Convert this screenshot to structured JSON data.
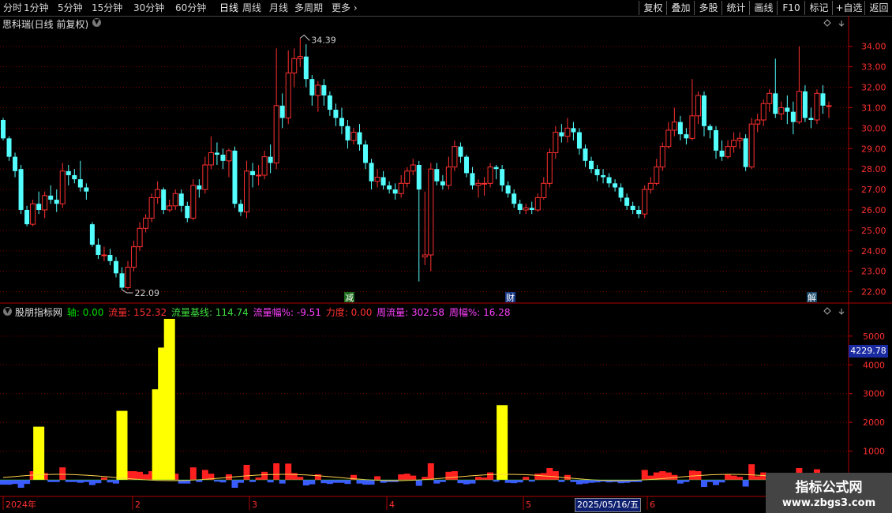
{
  "toolbar": {
    "periods": [
      "分时",
      "1分钟",
      "5分钟",
      "15分钟",
      "30分钟",
      "60分钟",
      "日线",
      "周线",
      "月线",
      "多周期",
      "更多"
    ],
    "active_period": "日线",
    "right_buttons": [
      "复权",
      "叠加",
      "多股",
      "统计",
      "画线",
      "F10",
      "标记",
      "+自选",
      "返回"
    ]
  },
  "stock": {
    "title": "思科瑞(日线 前复权)",
    "high_label": "34.39",
    "low_label": "22.09"
  },
  "price_axis": [
    "34.00",
    "33.00",
    "32.00",
    "31.00",
    "30.00",
    "29.00",
    "28.00",
    "27.00",
    "26.00",
    "25.00",
    "24.00",
    "23.00",
    "22.00"
  ],
  "markers": {
    "reduce": "减",
    "finance": "财",
    "unlock": "解"
  },
  "indicator": {
    "name": "股朋指标网",
    "axis_label": "轴: 0.00",
    "flow_label": "流量: 152.32",
    "baseline_label": "流量基线: 114.74",
    "flow_pct_label": "流量幅%: -9.51",
    "force_label": "力度: 0.00",
    "weekly_flow_label": "周流量: 302.58",
    "weekly_pct_label": "周幅%: 16.28",
    "axis_ticks": [
      "5000",
      "4000",
      "3000",
      "2000",
      "1000"
    ],
    "current_value": "4229.78"
  },
  "date_axis": {
    "labels": [
      "2024年",
      "2",
      "3",
      "4",
      "5",
      "6"
    ],
    "highlight": "2025/05/16/五"
  },
  "watermark": {
    "line1": "指标公式网",
    "line2": "www.zbgs3.com"
  },
  "colors": {
    "up": "#ff3030",
    "down": "#54ffff",
    "volume_spike": "#ffff00",
    "neg_bar": "#3a5cff",
    "grid": "#8b0000"
  },
  "chart_data": {
    "type": "candlestick",
    "ylim": [
      21.6,
      34.8
    ],
    "candles": [
      [
        30.4,
        29.5,
        30.5,
        29.4
      ],
      [
        29.5,
        28.6,
        29.6,
        28.4
      ],
      [
        28.6,
        27.9,
        28.8,
        27.6
      ],
      [
        28.0,
        26.0,
        28.2,
        25.8
      ],
      [
        26.0,
        25.3,
        26.2,
        25.2
      ],
      [
        25.3,
        26.3,
        26.5,
        25.2
      ],
      [
        26.3,
        26.0,
        26.9,
        25.8
      ],
      [
        26.0,
        26.7,
        26.9,
        25.6
      ],
      [
        26.7,
        26.5,
        27.2,
        26.3
      ],
      [
        26.5,
        26.3,
        27.0,
        25.9
      ],
      [
        26.3,
        27.9,
        28.3,
        26.1
      ],
      [
        27.9,
        27.7,
        28.2,
        27.2
      ],
      [
        27.7,
        27.5,
        28.0,
        27.3
      ],
      [
        27.5,
        27.1,
        28.4,
        26.9
      ],
      [
        27.1,
        26.9,
        27.3,
        26.5
      ],
      [
        25.3,
        24.3,
        25.4,
        24.2
      ],
      [
        24.3,
        23.8,
        24.6,
        23.6
      ],
      [
        23.8,
        23.8,
        24.2,
        23.5
      ],
      [
        23.8,
        23.5,
        24.1,
        23.3
      ],
      [
        23.5,
        22.9,
        23.7,
        22.7
      ],
      [
        22.9,
        22.2,
        23.2,
        22.1
      ],
      [
        22.2,
        23.2,
        23.5,
        22.1
      ],
      [
        23.2,
        24.2,
        24.5,
        23.0
      ],
      [
        24.2,
        25.1,
        25.4,
        24.0
      ],
      [
        25.1,
        25.6,
        25.8,
        24.9
      ],
      [
        25.6,
        26.6,
        26.8,
        25.4
      ],
      [
        26.6,
        27.0,
        27.4,
        26.3
      ],
      [
        27.0,
        26.0,
        27.1,
        25.8
      ],
      [
        26.0,
        26.2,
        26.5,
        25.9
      ],
      [
        26.2,
        26.8,
        27.0,
        26.0
      ],
      [
        26.8,
        26.2,
        27.0,
        25.9
      ],
      [
        26.2,
        25.6,
        26.4,
        25.4
      ],
      [
        25.6,
        27.2,
        27.5,
        25.5
      ],
      [
        27.2,
        27.0,
        27.5,
        26.6
      ],
      [
        27.0,
        28.2,
        28.6,
        26.8
      ],
      [
        28.2,
        28.8,
        29.6,
        28.0
      ],
      [
        28.8,
        28.7,
        29.3,
        28.2
      ],
      [
        28.7,
        28.4,
        29.0,
        28.0
      ],
      [
        28.4,
        28.9,
        29.0,
        27.6
      ],
      [
        28.9,
        26.3,
        29.1,
        26.1
      ],
      [
        26.3,
        25.9,
        26.5,
        25.7
      ],
      [
        25.9,
        27.9,
        28.4,
        25.6
      ],
      [
        27.9,
        27.7,
        28.3,
        27.1
      ],
      [
        27.7,
        27.7,
        28.2,
        27.2
      ],
      [
        27.7,
        28.6,
        28.9,
        27.5
      ],
      [
        28.6,
        28.3,
        29.2,
        27.8
      ],
      [
        28.3,
        31.1,
        33.9,
        28.0
      ],
      [
        31.1,
        30.5,
        31.7,
        30.0
      ],
      [
        30.5,
        32.7,
        33.8,
        30.2
      ],
      [
        32.7,
        33.4,
        33.9,
        32.0
      ],
      [
        33.4,
        33.5,
        34.4,
        33.0
      ],
      [
        33.5,
        32.4,
        34.1,
        32.0
      ],
      [
        32.4,
        31.6,
        32.6,
        31.1
      ],
      [
        31.6,
        32.1,
        32.3,
        30.8
      ],
      [
        32.1,
        31.6,
        32.4,
        31.1
      ],
      [
        31.6,
        30.9,
        31.8,
        30.6
      ],
      [
        30.9,
        30.5,
        31.2,
        30.1
      ],
      [
        30.5,
        30.1,
        31.0,
        29.7
      ],
      [
        30.1,
        29.4,
        30.4,
        29.0
      ],
      [
        29.4,
        29.8,
        30.0,
        29.2
      ],
      [
        29.8,
        29.2,
        30.2,
        28.9
      ],
      [
        29.2,
        28.3,
        29.4,
        28.0
      ],
      [
        28.3,
        27.4,
        28.5,
        27.0
      ],
      [
        27.4,
        27.6,
        28.0,
        27.1
      ],
      [
        27.6,
        27.2,
        27.9,
        27.0
      ],
      [
        27.2,
        27.0,
        27.4,
        26.8
      ],
      [
        27.0,
        26.8,
        27.3,
        26.5
      ],
      [
        26.8,
        27.3,
        27.7,
        26.6
      ],
      [
        27.3,
        27.9,
        28.1,
        27.1
      ],
      [
        27.9,
        28.2,
        28.5,
        27.7
      ],
      [
        28.2,
        27.0,
        28.4,
        22.5
      ],
      [
        23.7,
        23.8,
        26.9,
        23.3
      ],
      [
        23.8,
        28.0,
        28.3,
        23.0
      ],
      [
        28.0,
        27.4,
        28.3,
        27.2
      ],
      [
        27.4,
        27.2,
        27.7,
        27.0
      ],
      [
        27.2,
        28.1,
        28.6,
        27.0
      ],
      [
        28.1,
        29.1,
        29.4,
        27.9
      ],
      [
        29.1,
        28.6,
        29.3,
        28.3
      ],
      [
        28.6,
        27.8,
        28.7,
        27.6
      ],
      [
        27.8,
        27.2,
        28.1,
        27.0
      ],
      [
        27.2,
        27.3,
        27.5,
        26.6
      ],
      [
        27.3,
        27.3,
        27.6,
        26.7
      ],
      [
        27.3,
        28.1,
        28.3,
        27.1
      ],
      [
        28.1,
        28.0,
        28.2,
        27.5
      ],
      [
        28.0,
        27.2,
        28.2,
        26.9
      ],
      [
        27.2,
        26.8,
        27.4,
        26.6
      ],
      [
        26.8,
        26.3,
        27.0,
        26.1
      ],
      [
        26.3,
        26.0,
        26.5,
        25.8
      ],
      [
        26.0,
        26.1,
        26.3,
        25.8
      ],
      [
        26.1,
        26.0,
        26.4,
        25.8
      ],
      [
        26.0,
        26.6,
        26.8,
        25.9
      ],
      [
        26.6,
        27.3,
        27.6,
        26.5
      ],
      [
        27.3,
        28.8,
        29.0,
        27.1
      ],
      [
        28.8,
        29.8,
        30.1,
        28.5
      ],
      [
        29.8,
        29.6,
        30.2,
        29.3
      ],
      [
        29.6,
        30.0,
        30.5,
        29.3
      ],
      [
        30.0,
        29.8,
        30.3,
        29.4
      ],
      [
        29.8,
        29.0,
        30.0,
        28.7
      ],
      [
        29.0,
        28.4,
        29.2,
        28.1
      ],
      [
        28.4,
        28.0,
        28.6,
        27.8
      ],
      [
        28.0,
        27.7,
        28.2,
        27.4
      ],
      [
        27.7,
        27.6,
        28.0,
        27.3
      ],
      [
        27.6,
        27.3,
        27.8,
        27.1
      ],
      [
        27.3,
        27.1,
        27.5,
        26.9
      ],
      [
        27.1,
        26.6,
        27.3,
        26.4
      ],
      [
        26.6,
        26.2,
        26.8,
        26.0
      ],
      [
        26.2,
        26.0,
        26.4,
        25.8
      ],
      [
        26.0,
        25.8,
        26.2,
        25.6
      ],
      [
        25.8,
        27.0,
        27.2,
        25.6
      ],
      [
        27.0,
        27.3,
        27.6,
        26.8
      ],
      [
        27.3,
        28.1,
        28.5,
        27.2
      ],
      [
        28.1,
        29.1,
        29.3,
        27.9
      ],
      [
        29.1,
        29.9,
        30.3,
        29.0
      ],
      [
        29.9,
        30.3,
        31.0,
        29.6
      ],
      [
        30.3,
        29.7,
        30.6,
        29.4
      ],
      [
        29.7,
        29.5,
        30.0,
        29.2
      ],
      [
        29.5,
        30.6,
        32.4,
        29.4
      ],
      [
        30.6,
        31.6,
        31.8,
        30.2
      ],
      [
        31.6,
        30.1,
        31.8,
        29.6
      ],
      [
        30.1,
        29.9,
        30.2,
        29.5
      ],
      [
        29.9,
        28.9,
        30.1,
        28.5
      ],
      [
        28.9,
        28.6,
        29.4,
        28.4
      ],
      [
        28.6,
        29.1,
        29.4,
        28.5
      ],
      [
        29.1,
        29.4,
        29.8,
        28.8
      ],
      [
        29.4,
        29.5,
        29.8,
        29.0
      ],
      [
        29.5,
        28.1,
        29.7,
        27.9
      ],
      [
        28.1,
        30.2,
        30.5,
        28.0
      ],
      [
        30.2,
        30.4,
        30.7,
        29.8
      ],
      [
        30.4,
        31.2,
        31.4,
        30.1
      ],
      [
        31.2,
        31.7,
        31.9,
        30.8
      ],
      [
        31.7,
        30.7,
        33.4,
        30.5
      ],
      [
        30.7,
        31.0,
        31.3,
        30.4
      ],
      [
        31.0,
        30.8,
        31.6,
        30.2
      ],
      [
        30.8,
        30.3,
        31.3,
        29.7
      ],
      [
        30.3,
        31.8,
        34.0,
        30.2
      ],
      [
        31.8,
        30.5,
        32.1,
        30.3
      ],
      [
        30.5,
        30.4,
        31.0,
        30.0
      ],
      [
        30.4,
        31.7,
        31.9,
        30.2
      ],
      [
        31.7,
        31.1,
        32.1,
        30.7
      ],
      [
        31.1,
        31.1,
        31.3,
        30.5
      ]
    ],
    "volume_spikes": [
      [
        6,
        1850
      ],
      [
        20,
        2400
      ],
      [
        26,
        3150
      ],
      [
        27,
        4600
      ],
      [
        28,
        5600
      ],
      [
        84,
        2600
      ]
    ]
  }
}
